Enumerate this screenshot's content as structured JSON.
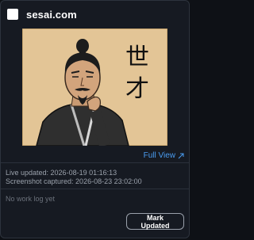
{
  "header": {
    "title": "sesai.com",
    "checked": false
  },
  "thumbnail": {
    "calligraphy": "世才"
  },
  "actions": {
    "full_view_label": "Full View",
    "full_view_icon": "external-arrow-icon",
    "mark_updated_label": "Mark Updated"
  },
  "meta": {
    "live_updated": "Live updated: 2026-08-19 01:16:13",
    "screenshot_captured": "Screenshot captured: 2026-08-23 23:02:00"
  },
  "worklog": {
    "empty_text": "No work log yet"
  },
  "colors": {
    "accent_link": "#4a9cf0",
    "card_bg": "#161a22",
    "page_bg": "#0e1116"
  }
}
